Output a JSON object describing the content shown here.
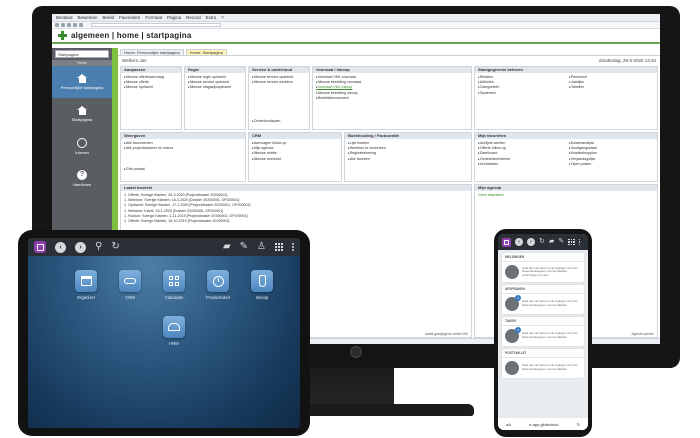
{
  "monitor": {
    "menu": [
      "Bestand",
      "Bewerken",
      "Beeld",
      "Favorieten",
      "Formaat",
      "Pagina",
      "Record",
      "Extra",
      "?"
    ],
    "app_title": "algemeen | home | startpagina",
    "sidebar": {
      "select_value": "Startpagina",
      "header": "Home",
      "items": [
        {
          "label": "Persoonlijke startpagina"
        },
        {
          "label": "Startpagina"
        },
        {
          "label": "Internet"
        },
        {
          "label": "Handboek"
        }
      ]
    },
    "tabs": [
      "Home: Persoonlijke startpagina",
      "Home: Startpagina"
    ],
    "welcome": "Welkom Jan",
    "date": "donderdag, 26-3-2020 13:34",
    "panels": {
      "aanpassen": {
        "title": "Aanpassen",
        "items": [
          "Nieuwe offerteaanvraag",
          "Nieuwe offerte",
          "Nieuwe opdracht"
        ]
      },
      "regie": {
        "title": "Regie",
        "items": [
          "Nieuwe regie opdracht",
          "Nieuwe service opdracht",
          "Nieuwe magazijnopdracht"
        ]
      },
      "service": {
        "title": "Service & onderhoud",
        "items": [
          "Nieuwe service opdracht",
          "Nieuwe service werkbon",
          "Onderhoudsplan"
        ]
      },
      "voorraad": {
        "title": "Voorraad / Inkoop",
        "items": [
          "Voorraad VML voorraad",
          "Nieuwe bestelling voorraad",
          "Voorraad VML inkoop",
          "Nieuwe bestelling inkoop",
          "Bestellabonnement"
        ],
        "link_index": 2
      },
      "stamgegevens": {
        "title": "Stamgegevens beheren",
        "col1": [
          "Relaties",
          "Artikelen",
          "Categorieën",
          "Systemen"
        ],
        "col2": [
          "Personeel",
          "Jaarlijks",
          "Tabellen"
        ]
      },
      "weergaven": {
        "title": "Weergaven",
        "items": [
          "Alle documenten",
          "Alle projectdossiers en orders",
          "Gîte portaal"
        ]
      },
      "crm": {
        "title": "CRM",
        "items": [
          "Aanvragen follow up",
          "Mijn agenda",
          "Nieuwe relatie",
          "Nieuwe overzicht"
        ]
      },
      "boekhouding": {
        "title": "Boekhouding / Factuurafdr",
        "items": [
          "Lijst boeken",
          "Werkbon te verwerken",
          "Regieafrekening",
          "Alle facturen"
        ]
      },
      "favorieten": {
        "title": "Mijn favorieten",
        "col1": [
          "Uurlijste werken",
          "Offerte follow up",
          "Dashboard",
          "Gedetectieerdienst",
          "Urenbladen"
        ],
        "col2": [
          "Kostenanalyse",
          "Voortgangsstaat",
          "Kwaliteitsopplan",
          "Verjaardagslijst",
          "Open posten"
        ]
      },
      "laatst": {
        "title": "Laatst bewerkt",
        "items": [
          "1. Offerte: Sverige Klanten, 26-3-2020 [Projectdossier 20200001]",
          "1. Werkbon: Sverige Klanten, 18-3-2020 [Dossier 20200006, OP200001]",
          "1. Opdracht: Sverige Klanten, 17-1-2020 [Projectdossier 20200001, OP200001]",
          "1. Werkbon: Klantt, 16-1-2020 [Dossier 20200006, OP200001]",
          "1. Factuur: Sverige Klanten, 2-11-2019 [Projectdossier 20190001, OP190001]",
          "1. Offerte: Sverige Klanten, 18-10-2019 [Projectdossier 20190001]"
        ],
        "footer": "Laatst gewijzigd en verder 000"
      },
      "agenda": {
        "title": "Mijn agenda",
        "link": "Geen afspraken",
        "footer": "Agenda openen"
      }
    }
  },
  "tablet": {
    "tiles": [
      {
        "label": "Organizer"
      },
      {
        "label": "CRM"
      },
      {
        "label": "Calculatie"
      },
      {
        "label": "Productiviteit"
      },
      {
        "label": "Inkoop"
      },
      {
        "label": "HRM"
      }
    ]
  },
  "phone": {
    "cards": [
      {
        "title": "MELDINGEN",
        "text": "Gaat hier een tekst om de ingangen voor het beheerbeheergeen voor de plaatsen, onderdingen en meer",
        "badge": ""
      },
      {
        "title": "AFSPRAKEN",
        "text": "Gaat hier een tekst om de ingangen voor het beheerbeheergeen voor de plaatsen",
        "badge": "1"
      },
      {
        "title": "TAKEN",
        "text": "Gaat hier een tekst om de ingangen voor het beheerbeheergeen voor de plaatsen",
        "badge": "3"
      },
      {
        "title": "POSTVAK-UIT",
        "text": "Gaat hier een tekst om de ingangen voor het beheerbeheergeen voor de plaatsen",
        "badge": ""
      }
    ],
    "url_aa": "aA",
    "url": "e-app.gildecloud"
  }
}
